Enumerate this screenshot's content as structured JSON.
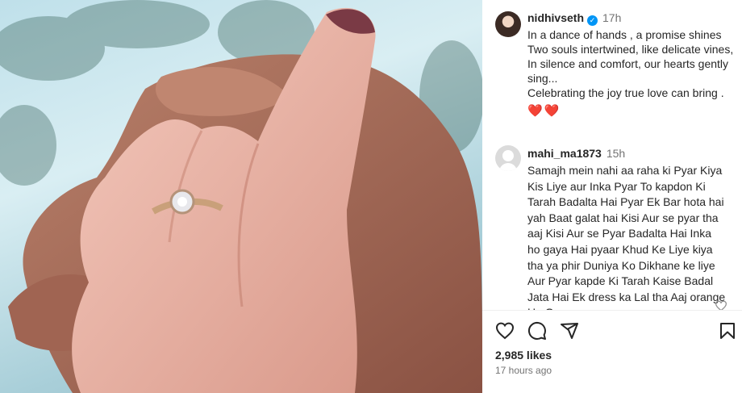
{
  "post": {
    "username": "nidhivseth",
    "time": "17h",
    "caption": "In a dance of hands , a promise shines\nTwo souls intertwined, like delicate vines,\nIn silence and comfort, our hearts gently sing...\nCelebrating the joy true love can bring .",
    "hearts": "❤️❤️"
  },
  "comment": {
    "username": "mahi_ma1873",
    "time": "15h",
    "text": "Samajh mein nahi aa raha ki Pyar Kiya Kis Liye aur Inka Pyar To kapdon Ki Tarah Badalta Hai Pyar Ek Bar hota hai yah Baat galat hai Kisi Aur se pyar tha aaj Kisi Aur se Pyar Badalta Hai Inka ho gaya Hai pyaar Khud Ke Liye kiya tha ya phir Duniya Ko Dikhane ke liye Aur Pyar kapde Ki Tarah Kaise Badal Jata Hai Ek dress ka Lal tha Aaj orange Ho Gaya"
  },
  "stats": {
    "likes": "2,985 likes",
    "ago": "17 hours ago"
  },
  "icons": {
    "like": "heart-icon",
    "comment": "comment-icon",
    "share": "share-icon",
    "save": "bookmark-icon"
  },
  "colors": {
    "verified": "#0095f6",
    "heart": "#e0243d"
  }
}
